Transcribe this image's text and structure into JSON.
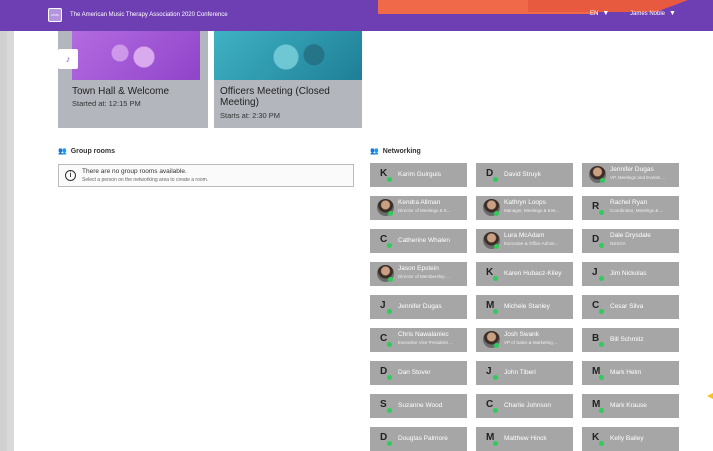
{
  "topbar": {
    "logo_text": "AMTA",
    "title": "The American Music Therapy Association 2020 Conference",
    "language": "EN",
    "user_name": "James Noble"
  },
  "sessions": [
    {
      "title": "Town Hall & Welcome",
      "time": "Started at: 12:15 PM"
    },
    {
      "title": "Officers Meeting (Closed Meeting)",
      "time": "Starts at: 2:30 PM"
    }
  ],
  "group_rooms": {
    "title": "Group rooms",
    "empty_message": "There are no group rooms available.",
    "empty_hint": "Select a person on the networking area to create a room."
  },
  "networking": {
    "title": "Networking",
    "people": [
      {
        "initial": "K",
        "name": "Karim Guirguis",
        "role": ""
      },
      {
        "initial": "D",
        "name": "David Struyk",
        "role": ""
      },
      {
        "initial": "",
        "name": "Jennifer Dugas",
        "role": "VP, Meetings and Events ..."
      },
      {
        "initial": "",
        "name": "Kendra Allman",
        "role": "Director of Meetings & E..."
      },
      {
        "initial": "",
        "name": "Kathryn Loops",
        "role": "Manager, Meetings & Eve..."
      },
      {
        "initial": "R",
        "name": "Rachel Ryan",
        "role": "Coordinator, Meetings & ..."
      },
      {
        "initial": "C",
        "name": "Catherine Whalen",
        "role": ""
      },
      {
        "initial": "",
        "name": "Lura McAdam",
        "role": "Executive & Office Admin..."
      },
      {
        "initial": "D",
        "name": "Dale Drysdale",
        "role": "NSSGA"
      },
      {
        "initial": "",
        "name": "Jason Epstein",
        "role": "Director of Membership ..."
      },
      {
        "initial": "K",
        "name": "Karen Hubacz-Kiley",
        "role": ""
      },
      {
        "initial": "J",
        "name": "Jim Nickolas",
        "role": ""
      },
      {
        "initial": "J",
        "name": "Jennifer Dugas",
        "role": ""
      },
      {
        "initial": "M",
        "name": "Michele Stanley",
        "role": ""
      },
      {
        "initial": "C",
        "name": "Cesar Silva",
        "role": ""
      },
      {
        "initial": "C",
        "name": "Chris Nawalaniec",
        "role": "Executive Vice President ..."
      },
      {
        "initial": "",
        "name": "Josh Swank",
        "role": "VP of Sales & Marketing ..."
      },
      {
        "initial": "B",
        "name": "Bill Schmitz",
        "role": ""
      },
      {
        "initial": "D",
        "name": "Dan Stover",
        "role": ""
      },
      {
        "initial": "J",
        "name": "John Tiberi",
        "role": ""
      },
      {
        "initial": "M",
        "name": "Mark Helm",
        "role": ""
      },
      {
        "initial": "S",
        "name": "Suzanne Wood",
        "role": ""
      },
      {
        "initial": "C",
        "name": "Charlie Johnson",
        "role": ""
      },
      {
        "initial": "M",
        "name": "Mark Krause",
        "role": ""
      },
      {
        "initial": "D",
        "name": "Douglas Palmore",
        "role": ""
      },
      {
        "initial": "M",
        "name": "Matthew Hinck",
        "role": ""
      },
      {
        "initial": "K",
        "name": "Kelly Bailey",
        "role": ""
      }
    ]
  },
  "colors": {
    "topbar": "#6e3fb3",
    "accent": "#f06a4a",
    "online": "#2ecc5a",
    "card": "#a6a6a6"
  },
  "icons": {
    "group": "group-icon",
    "networking": "networking-icon",
    "info": "info-icon",
    "caret": "caret-down-icon"
  }
}
